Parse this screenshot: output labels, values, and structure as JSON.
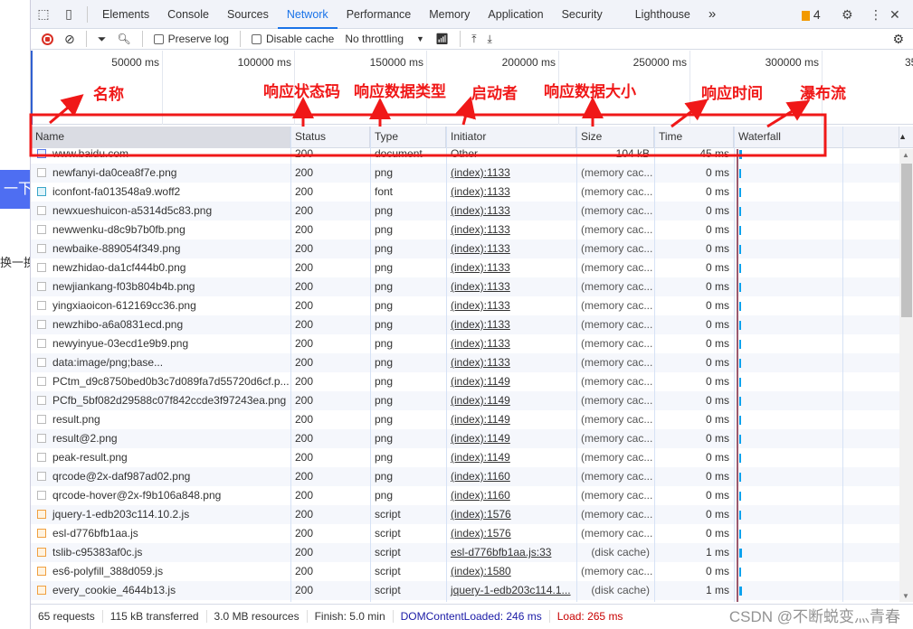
{
  "page_behind": {
    "button_text": "一下",
    "link_text": "换一换"
  },
  "tabbar": {
    "tabs": [
      "Elements",
      "Console",
      "Sources",
      "Network",
      "Performance",
      "Memory",
      "Application",
      "Security",
      "Lighthouse"
    ],
    "active": "Network",
    "issues_count": "4",
    "more": "»"
  },
  "toolbar": {
    "preserve_log": "Preserve log",
    "disable_cache": "Disable cache",
    "throttling": "No throttling"
  },
  "overview": {
    "ticks": [
      "50000 ms",
      "100000 ms",
      "150000 ms",
      "200000 ms",
      "250000 ms",
      "300000 ms",
      "35"
    ]
  },
  "columns": [
    "Name",
    "Status",
    "Type",
    "Initiator",
    "Size",
    "Time",
    "Waterfall"
  ],
  "rows": [
    {
      "name": "www.baidu.com",
      "status": "200",
      "type": "document",
      "initiator": "Other",
      "size": "104 kB",
      "time": "45 ms",
      "icon": "doc"
    },
    {
      "name": "newfanyi-da0cea8f7e.png",
      "status": "200",
      "type": "png",
      "initiator": "(index):1133",
      "size": "(memory cac...",
      "time": "0 ms",
      "icon": "img"
    },
    {
      "name": "iconfont-fa013548a9.woff2",
      "status": "200",
      "type": "font",
      "initiator": "(index):1133",
      "size": "(memory cac...",
      "time": "0 ms",
      "icon": "font"
    },
    {
      "name": "newxueshuicon-a5314d5c83.png",
      "status": "200",
      "type": "png",
      "initiator": "(index):1133",
      "size": "(memory cac...",
      "time": "0 ms",
      "icon": "img"
    },
    {
      "name": "newwenku-d8c9b7b0fb.png",
      "status": "200",
      "type": "png",
      "initiator": "(index):1133",
      "size": "(memory cac...",
      "time": "0 ms",
      "icon": "img"
    },
    {
      "name": "newbaike-889054f349.png",
      "status": "200",
      "type": "png",
      "initiator": "(index):1133",
      "size": "(memory cac...",
      "time": "0 ms",
      "icon": "img"
    },
    {
      "name": "newzhidao-da1cf444b0.png",
      "status": "200",
      "type": "png",
      "initiator": "(index):1133",
      "size": "(memory cac...",
      "time": "0 ms",
      "icon": "img"
    },
    {
      "name": "newjiankang-f03b804b4b.png",
      "status": "200",
      "type": "png",
      "initiator": "(index):1133",
      "size": "(memory cac...",
      "time": "0 ms",
      "icon": "img"
    },
    {
      "name": "yingxiaoicon-612169cc36.png",
      "status": "200",
      "type": "png",
      "initiator": "(index):1133",
      "size": "(memory cac...",
      "time": "0 ms",
      "icon": "img"
    },
    {
      "name": "newzhibo-a6a0831ecd.png",
      "status": "200",
      "type": "png",
      "initiator": "(index):1133",
      "size": "(memory cac...",
      "time": "0 ms",
      "icon": "img"
    },
    {
      "name": "newyinyue-03ecd1e9b9.png",
      "status": "200",
      "type": "png",
      "initiator": "(index):1133",
      "size": "(memory cac...",
      "time": "0 ms",
      "icon": "img"
    },
    {
      "name": "data:image/png;base...",
      "status": "200",
      "type": "png",
      "initiator": "(index):1133",
      "size": "(memory cac...",
      "time": "0 ms",
      "icon": "img"
    },
    {
      "name": "PCtm_d9c8750bed0b3c7d089fa7d55720d6cf.p...",
      "status": "200",
      "type": "png",
      "initiator": "(index):1149",
      "size": "(memory cac...",
      "time": "0 ms",
      "icon": "img"
    },
    {
      "name": "PCfb_5bf082d29588c07f842ccde3f97243ea.png",
      "status": "200",
      "type": "png",
      "initiator": "(index):1149",
      "size": "(memory cac...",
      "time": "0 ms",
      "icon": "img"
    },
    {
      "name": "result.png",
      "status": "200",
      "type": "png",
      "initiator": "(index):1149",
      "size": "(memory cac...",
      "time": "0 ms",
      "icon": "img"
    },
    {
      "name": "result@2.png",
      "status": "200",
      "type": "png",
      "initiator": "(index):1149",
      "size": "(memory cac...",
      "time": "0 ms",
      "icon": "img"
    },
    {
      "name": "peak-result.png",
      "status": "200",
      "type": "png",
      "initiator": "(index):1149",
      "size": "(memory cac...",
      "time": "0 ms",
      "icon": "img"
    },
    {
      "name": "qrcode@2x-daf987ad02.png",
      "status": "200",
      "type": "png",
      "initiator": "(index):1160",
      "size": "(memory cac...",
      "time": "0 ms",
      "icon": "img"
    },
    {
      "name": "qrcode-hover@2x-f9b106a848.png",
      "status": "200",
      "type": "png",
      "initiator": "(index):1160",
      "size": "(memory cac...",
      "time": "0 ms",
      "icon": "img"
    },
    {
      "name": "jquery-1-edb203c114.10.2.js",
      "status": "200",
      "type": "script",
      "initiator": "(index):1576",
      "size": "(memory cac...",
      "time": "0 ms",
      "icon": "js"
    },
    {
      "name": "esl-d776bfb1aa.js",
      "status": "200",
      "type": "script",
      "initiator": "(index):1576",
      "size": "(memory cac...",
      "time": "0 ms",
      "icon": "js"
    },
    {
      "name": "tslib-c95383af0c.js",
      "status": "200",
      "type": "script",
      "initiator": "esl-d776bfb1aa.js:33",
      "size": "(disk cache)",
      "time": "1 ms",
      "icon": "js"
    },
    {
      "name": "es6-polyfill_388d059.js",
      "status": "200",
      "type": "script",
      "initiator": "(index):1580",
      "size": "(memory cac...",
      "time": "0 ms",
      "icon": "js"
    },
    {
      "name": "every_cookie_4644b13.js",
      "status": "200",
      "type": "script",
      "initiator": "jquery-1-edb203c114.1...",
      "size": "(disk cache)",
      "time": "1 ms",
      "icon": "js"
    }
  ],
  "statusbar": {
    "requests": "65 requests",
    "transferred": "115 kB transferred",
    "resources": "3.0 MB resources",
    "finish": "Finish: 5.0 min",
    "dcl": "DOMContentLoaded: 246 ms",
    "load": "Load: 265 ms"
  },
  "annotations": {
    "name": "名称",
    "status": "响应状态码",
    "type": "响应数据类型",
    "initiator": "启动者",
    "size": "响应数据大小",
    "time": "响应时间",
    "waterfall": "瀑布流",
    "color": "#f01818"
  },
  "watermark": "CSDN @不断蜕变灬青春",
  "colors": {
    "accent": "#1a73e8",
    "dcl": "#1a1aa6",
    "load": "#c80000"
  }
}
